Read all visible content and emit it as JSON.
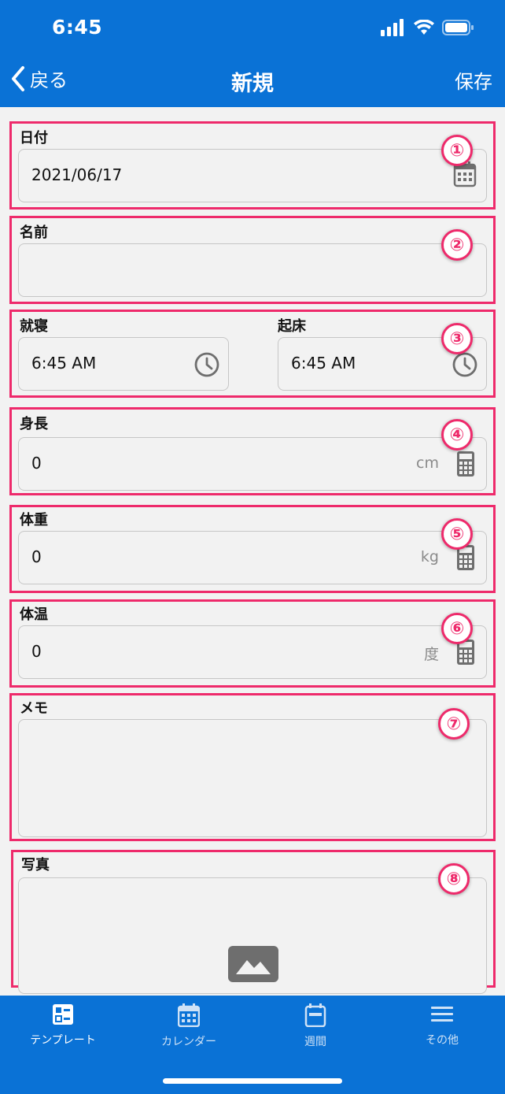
{
  "status": {
    "time": "6:45"
  },
  "nav": {
    "back_label": "戻る",
    "title": "新規",
    "save_label": "保存"
  },
  "form": {
    "date": {
      "label": "日付",
      "value": "2021/06/17",
      "badge": "①"
    },
    "name": {
      "label": "名前",
      "value": "",
      "badge": "②"
    },
    "sleep": {
      "label": "就寝",
      "value": "6:45 AM"
    },
    "wake": {
      "label": "起床",
      "value": "6:45 AM"
    },
    "sleep_badge": "③",
    "height": {
      "label": "身長",
      "value": "0",
      "unit": "cm",
      "badge": "④"
    },
    "weight": {
      "label": "体重",
      "value": "0",
      "unit": "kg",
      "badge": "⑤"
    },
    "temp": {
      "label": "体温",
      "value": "0",
      "unit": "度",
      "badge": "⑥"
    },
    "memo": {
      "label": "メモ",
      "value": "",
      "badge": "⑦"
    },
    "photo": {
      "label": "写真",
      "badge": "⑧"
    }
  },
  "tabs": [
    {
      "label": "テンプレート",
      "icon": "template-icon",
      "active": true
    },
    {
      "label": "カレンダー",
      "icon": "calendar-icon",
      "active": false
    },
    {
      "label": "週間",
      "icon": "week-icon",
      "active": false
    },
    {
      "label": "その他",
      "icon": "menu-icon",
      "active": false
    }
  ],
  "colors": {
    "primary": "#0a72d6",
    "highlight": "#ee2a6b",
    "background": "#f2f2f2"
  }
}
